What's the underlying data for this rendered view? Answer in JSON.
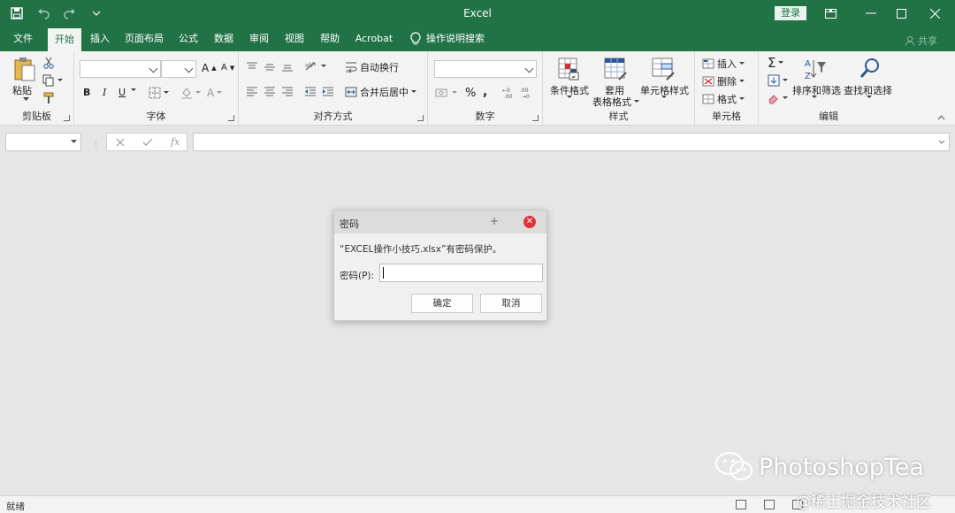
{
  "window": {
    "title": "Excel",
    "login_label": "登录"
  },
  "tabs": [
    "文件",
    "开始",
    "插入",
    "页面布局",
    "公式",
    "数据",
    "审阅",
    "视图",
    "帮助",
    "Acrobat"
  ],
  "tell_me": "操作说明搜索",
  "share_label": "共享",
  "ribbon": {
    "clipboard": {
      "label": "剪贴板",
      "paste": "粘贴"
    },
    "font": {
      "label": "字体",
      "bold": "B",
      "italic": "I",
      "underline": "U",
      "grow": "A",
      "shrink": "A"
    },
    "alignment": {
      "label": "对齐方式",
      "wrap": "自动换行",
      "merge": "合并后居中"
    },
    "number": {
      "label": "数字",
      "percent": "%",
      "comma": ","
    },
    "styles": {
      "label": "样式",
      "conditional": "条件格式",
      "table_line1": "套用",
      "table_line2": "表格格式",
      "cell_styles": "单元格样式"
    },
    "cells": {
      "label": "单元格",
      "insert": "插入",
      "delete": "删除",
      "format": "格式"
    },
    "editing": {
      "label": "编辑",
      "sum": "Σ",
      "sort": "排序和筛选",
      "find": "查找和选择"
    }
  },
  "formula_bar": {
    "fx": "fx"
  },
  "dialog": {
    "title": "密码",
    "pin": "+",
    "message": "“EXCEL操作小技巧.xlsx”有密码保护。",
    "field_label": "密码(P):",
    "password_value": "",
    "ok": "确定",
    "cancel": "取消"
  },
  "watermark": {
    "brand": "PhotoshopTea",
    "site": "@稀土掘金技术社区"
  },
  "status": {
    "text": "就绪"
  },
  "colors": {
    "excel_green": "#217346",
    "close_red": "#e0323c"
  }
}
